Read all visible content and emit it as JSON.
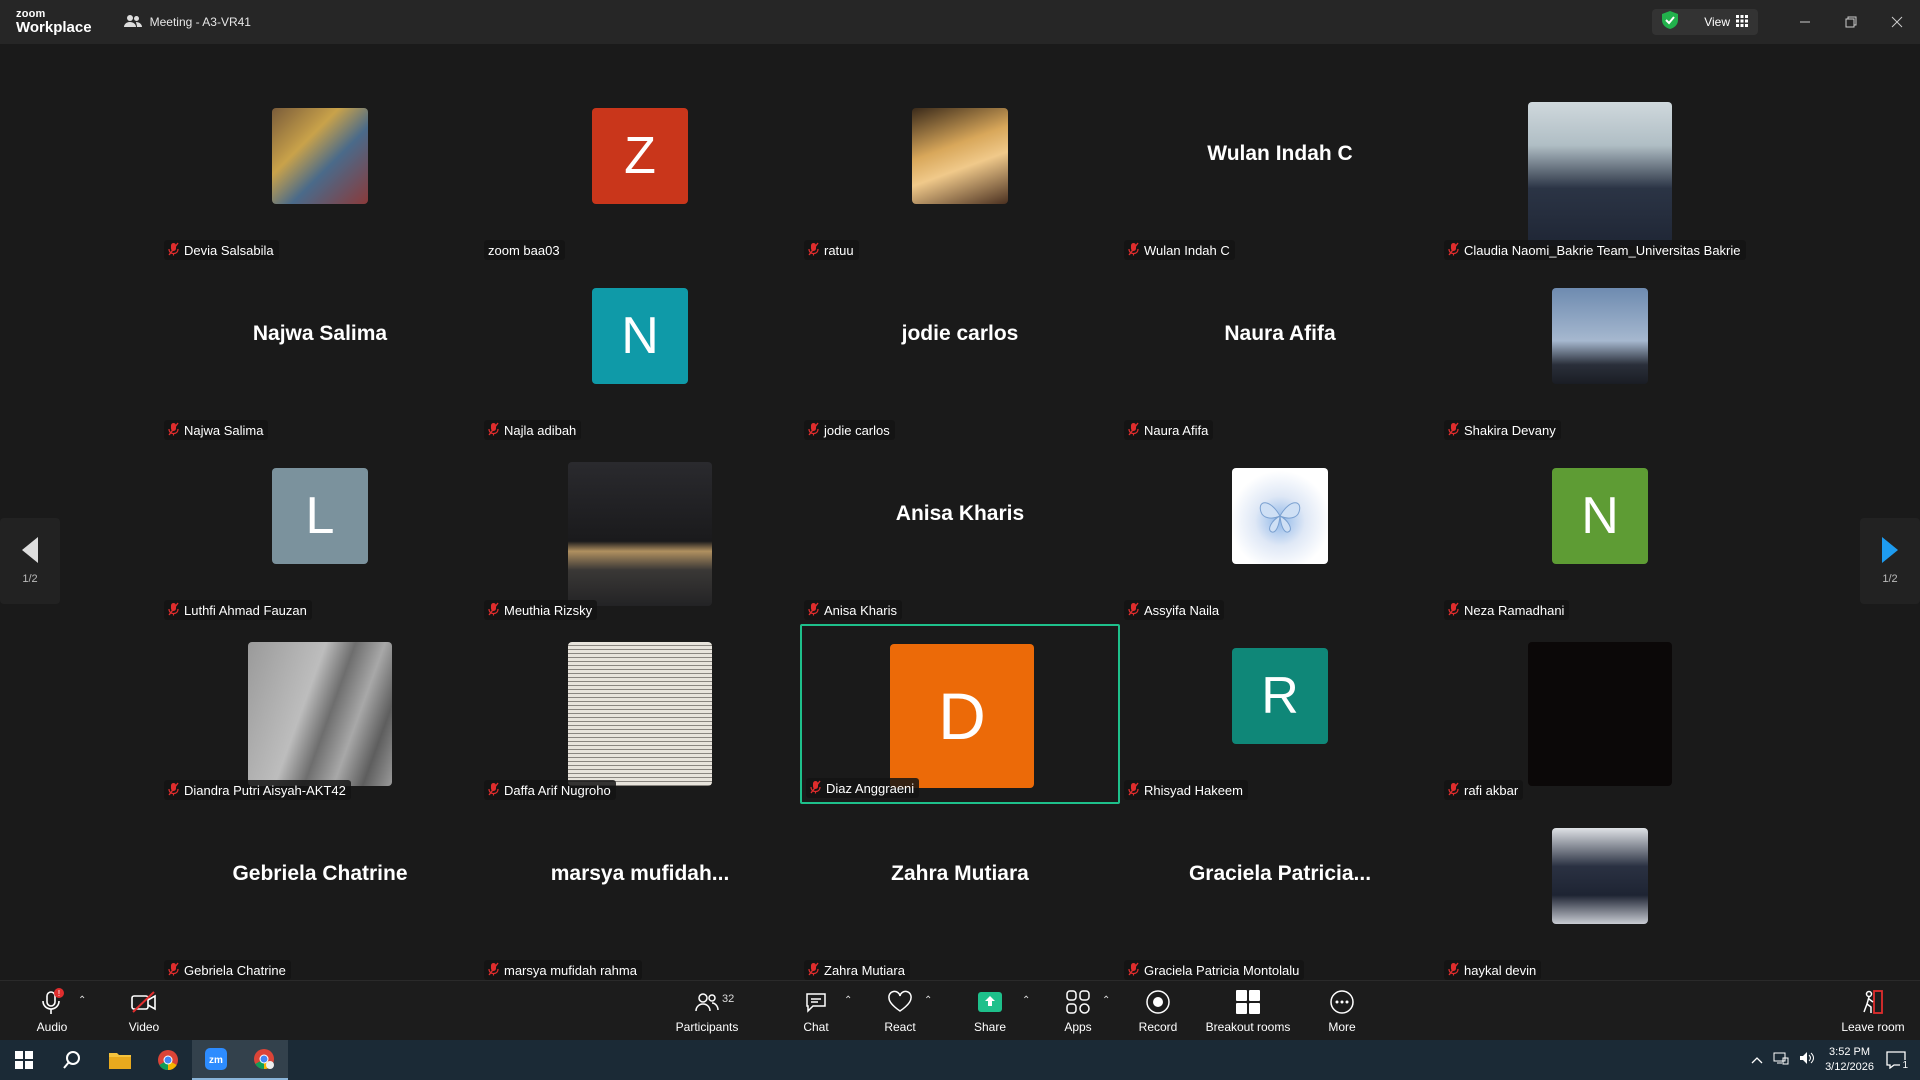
{
  "app": {
    "logo_top": "zoom",
    "logo_bottom": "Workplace",
    "meeting_title": "Meeting - A3-VR41",
    "view_label": "View"
  },
  "pager": {
    "left_label": "1/2",
    "right_label": "1/2"
  },
  "participants": [
    {
      "name": "Devia Salsabila",
      "avatar": "photo-bookstore",
      "muted": true
    },
    {
      "name": "zoom baa03",
      "avatar": "letter",
      "letter": "Z",
      "color": "#c9361b",
      "muted": false
    },
    {
      "name": "ratuu",
      "avatar": "photo-anime",
      "muted": true
    },
    {
      "name": "Wulan Indah C",
      "avatar": "name",
      "display_name": "Wulan Indah C",
      "muted": true
    },
    {
      "name": "Claudia Naomi_Bakrie Team_Universitas Bakrie",
      "avatar": "photo-video",
      "muted": true
    },
    {
      "name": "Najwa Salima",
      "avatar": "name",
      "display_name": "Najwa Salima",
      "muted": true
    },
    {
      "name": "Najla adibah",
      "avatar": "letter",
      "letter": "N",
      "color": "#0f9aa8",
      "muted": true
    },
    {
      "name": "jodie carlos",
      "avatar": "name",
      "display_name": "jodie carlos",
      "muted": true
    },
    {
      "name": "Naura Afifa",
      "avatar": "name",
      "display_name": "Naura Afifa",
      "muted": true
    },
    {
      "name": "Shakira Devany",
      "avatar": "photo-sky",
      "muted": true
    },
    {
      "name": "Luthfi Ahmad Fauzan",
      "avatar": "letter",
      "letter": "L",
      "color": "#7b929d",
      "muted": true
    },
    {
      "name": "Meuthia Rizsky",
      "avatar": "photo-night",
      "muted": true
    },
    {
      "name": "Anisa Kharis",
      "avatar": "name",
      "display_name": "Anisa Kharis",
      "muted": true
    },
    {
      "name": "Assyifa Naila",
      "avatar": "photo-butterfly",
      "muted": true
    },
    {
      "name": "Neza Ramadhani",
      "avatar": "letter",
      "letter": "N",
      "color": "#5e9c34",
      "muted": true
    },
    {
      "name": "Diandra Putri Aisyah-AKT42",
      "avatar": "photo-gray",
      "muted": true
    },
    {
      "name": "Daffa Arif Nugroho",
      "avatar": "photo-newspaper",
      "muted": true
    },
    {
      "name": "Diaz Anggraeni",
      "avatar": "letter-large",
      "letter": "D",
      "color": "#ec6a08",
      "muted": true,
      "active": true
    },
    {
      "name": "Rhisyad Hakeem",
      "avatar": "letter",
      "letter": "R",
      "color": "#0f8778",
      "muted": true
    },
    {
      "name": "rafi akbar",
      "avatar": "photo-black",
      "muted": true
    },
    {
      "name": "Gebriela Chatrine",
      "avatar": "name",
      "display_name": "Gebriela Chatrine",
      "muted": true
    },
    {
      "name": "marsya mufidah rahma",
      "avatar": "name",
      "display_name": "marsya  mufidah...",
      "muted": true
    },
    {
      "name": "Zahra Mutiara",
      "avatar": "name",
      "display_name": "Zahra Mutiara",
      "muted": true
    },
    {
      "name": "Graciela Patricia Montolalu",
      "avatar": "name",
      "display_name": "Graciela  Patricia...",
      "muted": true
    },
    {
      "name": "haykal devin",
      "avatar": "photo-legs",
      "muted": true
    }
  ],
  "toolbar": {
    "audio": "Audio",
    "video": "Video",
    "participants": "Participants",
    "participants_count": "32",
    "chat": "Chat",
    "react": "React",
    "share": "Share",
    "apps": "Apps",
    "record": "Record",
    "breakout": "Breakout rooms",
    "more": "More",
    "leave": "Leave room"
  },
  "taskbar": {
    "time": "3:52 PM",
    "date": "3/12/2026",
    "notifications": "1"
  },
  "colors": {
    "active_border": "#1ec08b",
    "share_green": "#1ec08b",
    "muted_red": "#e02d2d"
  }
}
